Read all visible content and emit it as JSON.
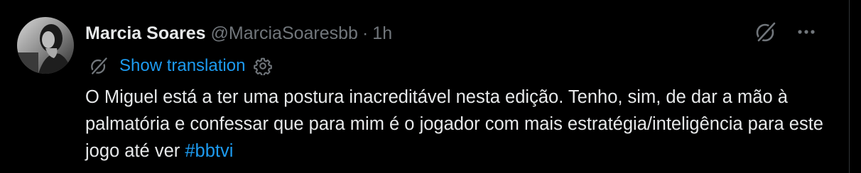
{
  "tweet": {
    "author_name": "Marcia Soares",
    "handle": "@MarciaSoaresbb",
    "separator": "·",
    "time": "1h",
    "translation_label": "Show translation",
    "text": "O Miguel está a ter uma postura inacreditável nesta edição. Tenho, sim, de dar a mão à palmatória e confessar que para mim é o jogador com mais estratégia/inteligência para este jogo até ver ",
    "hashtag": "#bbtvi"
  },
  "icons": {
    "avatar": "profile-photo",
    "header_grok": "grok-icon",
    "more": "more-horizontal-icon",
    "translate": "grok-translate-icon",
    "settings": "gear-icon"
  },
  "colors": {
    "background": "#000000",
    "text_primary": "#e7e9ea",
    "text_secondary": "#71767b",
    "accent": "#1d9bf0"
  }
}
